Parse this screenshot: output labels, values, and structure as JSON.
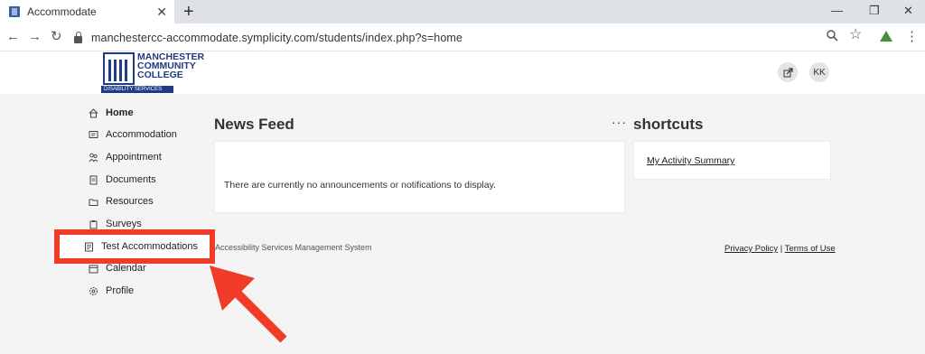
{
  "browser": {
    "tab_title": "Accommodate",
    "tab_close": "✕",
    "new_tab": "+",
    "window_controls": {
      "minimize": "—",
      "restore": "❐",
      "close": "✕"
    },
    "nav": {
      "back": "←",
      "forward": "→",
      "reload": "↻"
    },
    "url": "manchestercc-accommodate.symplicity.com/students/index.php?s=home",
    "icons": [
      "zoom-icon",
      "star-icon",
      "extension-icon",
      "menu-icon"
    ],
    "menu_glyph": "⋮",
    "star_glyph": "☆",
    "zoom_glyph": "🔍︎"
  },
  "header": {
    "logo_lines": [
      "MANCHESTER",
      "COMMUNITY",
      "COLLEGE"
    ],
    "logo_sub": "DISABILITY SERVICES",
    "user_initials": "KK",
    "colors": {
      "brand": "#1f3a87"
    }
  },
  "sidebar": {
    "items": [
      {
        "label": "Home",
        "icon": "home-icon",
        "active": true
      },
      {
        "label": "Accommodation",
        "icon": "message-icon"
      },
      {
        "label": "Appointment",
        "icon": "people-icon"
      },
      {
        "label": "Documents",
        "icon": "document-icon"
      },
      {
        "label": "Resources",
        "icon": "folder-icon"
      },
      {
        "label": "Surveys",
        "icon": "clipboard-icon"
      },
      {
        "label": "Test Accommodations",
        "icon": "test-icon"
      },
      {
        "label": "Calendar",
        "icon": "calendar-icon"
      },
      {
        "label": "Profile",
        "icon": "gear-icon"
      }
    ]
  },
  "main": {
    "news_title": "News Feed",
    "news_more": "···",
    "news_message": "There are currently no announcements or notifications to display.",
    "shortcuts_title": "shortcuts",
    "shortcut_link": "My Activity Summary"
  },
  "footer": {
    "left": "Accessibility Services Management System",
    "privacy": "Privacy Policy",
    "separator": "|",
    "terms": "Terms of Use"
  },
  "annotation": {
    "color": "#ef3b28"
  }
}
